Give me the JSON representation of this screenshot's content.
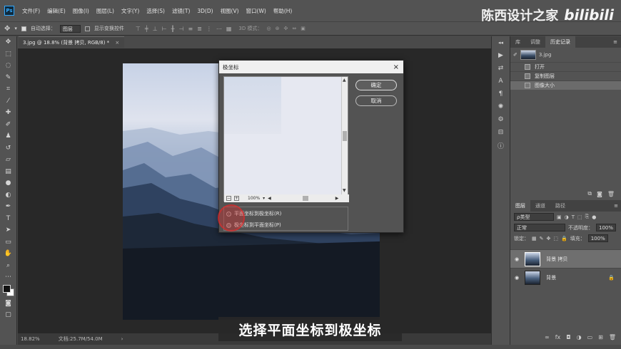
{
  "menubar": {
    "logo": "Ps",
    "items": [
      "文件(F)",
      "编辑(E)",
      "图像(I)",
      "图层(L)",
      "文字(Y)",
      "选择(S)",
      "滤镜(T)",
      "3D(D)",
      "视图(V)",
      "窗口(W)",
      "帮助(H)"
    ]
  },
  "watermark": {
    "text": "陈西设计之家",
    "logo": "bilibili"
  },
  "options": {
    "auto_select_label": "自动选择：",
    "auto_select_value": "图层",
    "show_transform_label": "显示变换控件",
    "mode_3d": "3D 模式："
  },
  "document": {
    "tab_title": "3.jpg @ 18.8% (背景 拷贝, RGB/8) *",
    "close": "×"
  },
  "status": {
    "zoom": "18.82%",
    "doc": "文档:25.7M/54.0M"
  },
  "history": {
    "tabs": [
      "库",
      "调整",
      "历史记录"
    ],
    "snapshot": "3.jpg",
    "items": [
      "打开",
      "复制图层",
      "图像大小"
    ],
    "selected": 2
  },
  "layers": {
    "tabs": [
      "图层",
      "通道",
      "路径"
    ],
    "kind": "ρ类型",
    "blend": "正常",
    "opacity_label": "不透明度：",
    "opacity": "100%",
    "lock_label": "锁定：",
    "fill_label": "填充：",
    "fill": "100%",
    "items": [
      {
        "name": "背景 拷贝",
        "selected": true,
        "locked": false
      },
      {
        "name": "背景",
        "selected": false,
        "locked": true
      }
    ]
  },
  "dialog": {
    "title": "极坐标",
    "close": "×",
    "ok": "确定",
    "cancel": "取消",
    "zoom": "100%",
    "options": [
      "平面坐标到极坐标(R)",
      "极坐标到平面坐标(P)"
    ],
    "selected_option": 0
  },
  "caption": "选择平面坐标到极坐标"
}
